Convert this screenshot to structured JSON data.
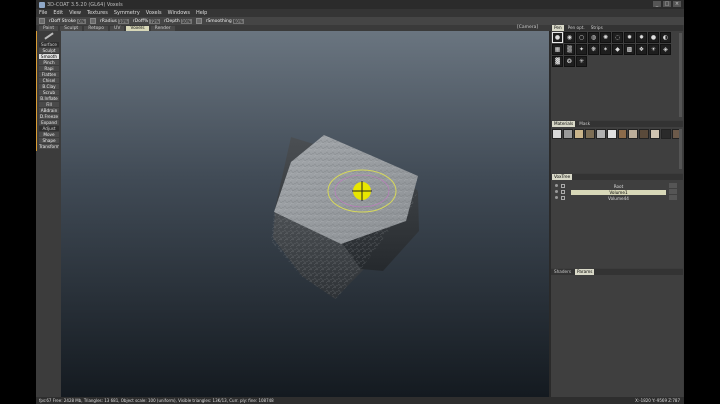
{
  "window": {
    "title": "3D-COAT 3.5.20 (GL64) Voxels",
    "controls": [
      "_",
      "□",
      "×"
    ]
  },
  "menu": [
    "File",
    "Edit",
    "View",
    "Textures",
    "Symmetry",
    "Voxels",
    "Windows",
    "Help"
  ],
  "toolbar": {
    "fields": [
      {
        "label": "rDoff  Stroke",
        "value": "0%"
      },
      {
        "label": "rRadius",
        "value": "10%"
      },
      {
        "label": "rDoff%",
        "value": "72%"
      },
      {
        "label": "rDepth",
        "value": "10%"
      },
      {
        "label": "rSmoothing",
        "value": "60%"
      }
    ]
  },
  "rooms": {
    "tabs": [
      "Paint",
      "Sculpt",
      "Retopo",
      "UV",
      "Voxels",
      "Render"
    ],
    "active_index": 4,
    "camera": "[Camera]"
  },
  "tools": [
    {
      "label": "Surface",
      "state": "header"
    },
    {
      "label": "Sculpt",
      "state": "normal"
    },
    {
      "label": "Smooth",
      "state": "active"
    },
    {
      "label": "Pinch",
      "state": "normal"
    },
    {
      "label": "Rapi",
      "state": "normal"
    },
    {
      "label": "Flatten",
      "state": "normal"
    },
    {
      "label": "Chisel",
      "state": "normal"
    },
    {
      "label": "B.Clay",
      "state": "normal"
    },
    {
      "label": "Scrub",
      "state": "normal"
    },
    {
      "label": "B.Inflate",
      "state": "normal"
    },
    {
      "label": "Fill",
      "state": "normal"
    },
    {
      "label": "ABdrain",
      "state": "normal"
    },
    {
      "label": "D.Freeze",
      "state": "normal"
    },
    {
      "label": "Expand",
      "state": "normal"
    },
    {
      "label": "Adjust",
      "state": "header"
    },
    {
      "label": "Move",
      "state": "normal"
    },
    {
      "label": "Shape",
      "state": "normal"
    },
    {
      "label": "Transform",
      "state": "normal"
    }
  ],
  "panels": {
    "alphas_tabs": [
      "Pen",
      "Pen opt.",
      "Strips"
    ],
    "materials_tabs": [
      "Materials",
      "Mask"
    ],
    "voxtree_tab": "VoxTree",
    "bottom_tabs": [
      "Shaders",
      "Params"
    ]
  },
  "voxtree": [
    {
      "name": "Root",
      "active": false
    },
    {
      "name": "Volume1",
      "active": true
    },
    {
      "name": "Volume44",
      "active": false
    }
  ],
  "status": {
    "text": "fps:67   Free: 2428 Mb, Triangles: 13 681, Object scale: 100 (uniform), Visible triangles: 13K/13, Curr. ply: fine: 108748",
    "coords": "X:-1820 Y:-9569 Z:787"
  },
  "colors": {
    "accent_orange": "#d89b33",
    "active_tab": "#d7d7b8",
    "brush_yellow": "#e8e600",
    "brush_ring": "#d6d85a"
  }
}
